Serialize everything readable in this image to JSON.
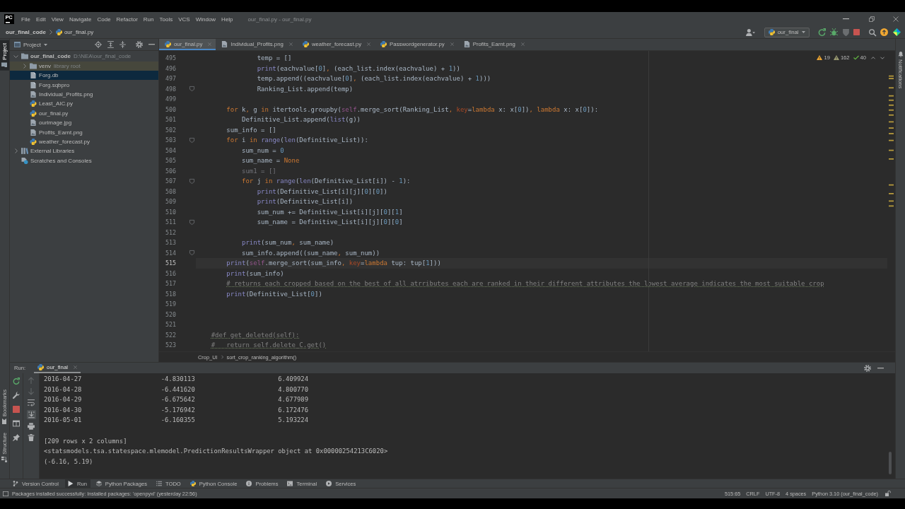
{
  "window": {
    "logo": "PC",
    "title": "our_final.py - our_final.py"
  },
  "menu": [
    "File",
    "Edit",
    "View",
    "Navigate",
    "Code",
    "Refactor",
    "Run",
    "Tools",
    "VCS",
    "Window",
    "Help"
  ],
  "navigation_bar": {
    "breadcrumb": [
      {
        "label": "our_final_code",
        "kind": "project"
      },
      {
        "label": "our_final.py",
        "kind": "python"
      }
    ],
    "run_configuration": "our_final"
  },
  "left_tool_strip": {
    "top": [
      {
        "label": "Project",
        "kind": "project",
        "selected": true
      }
    ],
    "bottom": [
      {
        "label": "Bookmarks",
        "kind": "bookmarks",
        "selected": false
      },
      {
        "label": "Structure",
        "kind": "structure",
        "selected": false
      }
    ]
  },
  "project_panel": {
    "title": "Project",
    "tree": [
      {
        "label": "our_final_code",
        "hint": "D:\\NEA\\our_final_code",
        "kind": "project",
        "expanded": true,
        "selected": false,
        "children": [
          {
            "label": "venv",
            "hint": "library root",
            "kind": "folder",
            "expanded": false,
            "selected": false,
            "color": "#46473c"
          },
          {
            "label": "Forg.db",
            "kind": "file",
            "selected": true
          },
          {
            "label": "Forg.sqbpro",
            "kind": "file",
            "selected": false
          },
          {
            "label": "Individual_Profits.png",
            "kind": "image",
            "selected": false
          },
          {
            "label": "Least_AIC.py",
            "kind": "python",
            "selected": false
          },
          {
            "label": "our_final.py",
            "kind": "python",
            "selected": false
          },
          {
            "label": "ourimage.jpg",
            "kind": "image",
            "selected": false
          },
          {
            "label": "Profits_Earnt.png",
            "kind": "image",
            "selected": false
          },
          {
            "label": "weather_forecast.py",
            "kind": "python",
            "selected": false
          }
        ]
      },
      {
        "label": "External Libraries",
        "kind": "library",
        "expanded": false,
        "selected": false
      },
      {
        "label": "Scratches and Consoles",
        "kind": "scratches",
        "selected": false
      }
    ]
  },
  "editor": {
    "tabs": [
      {
        "label": "our_final.py",
        "kind": "python",
        "selected": true
      },
      {
        "label": "Individual_Profits.png",
        "kind": "image",
        "selected": false
      },
      {
        "label": "weather_forecast.py",
        "kind": "python",
        "selected": false
      },
      {
        "label": "Passwordgenerator.py",
        "kind": "python",
        "selected": false
      },
      {
        "label": "Profits_Earnt.png",
        "kind": "image",
        "selected": false
      }
    ],
    "inspections": [
      {
        "kind": "warning",
        "count": "19"
      },
      {
        "kind": "weak_warning",
        "count": "162"
      },
      {
        "kind": "typo",
        "count": "40"
      }
    ],
    "lines": [
      {
        "number": "495",
        "current": false,
        "fold": false,
        "code": [
          {
            "text": "                temp = []",
            "kind": "txt"
          }
        ]
      },
      {
        "number": "496",
        "current": false,
        "fold": false,
        "code": [
          {
            "text": "                print",
            "kind": "fn"
          },
          {
            "text": "(eachvalue[",
            "kind": "txt"
          },
          {
            "text": "0",
            "kind": "num"
          },
          {
            "text": "]",
            "kind": "txt"
          },
          {
            "text": ",",
            "kind": "kw"
          },
          {
            "text": " (each_list.index(eachvalue) + ",
            "kind": "txt"
          },
          {
            "text": "1",
            "kind": "num"
          },
          {
            "text": "))",
            "kind": "txt"
          }
        ]
      },
      {
        "number": "497",
        "current": false,
        "fold": false,
        "code": [
          {
            "text": "                temp.append((eachvalue[",
            "kind": "txt"
          },
          {
            "text": "0",
            "kind": "num"
          },
          {
            "text": "]",
            "kind": "txt"
          },
          {
            "text": ",",
            "kind": "kw"
          },
          {
            "text": " (each_list.index(eachvalue) + ",
            "kind": "txt"
          },
          {
            "text": "1",
            "kind": "num"
          },
          {
            "text": ")))",
            "kind": "txt"
          }
        ]
      },
      {
        "number": "498",
        "current": false,
        "fold": true,
        "code": [
          {
            "text": "                Ranking_List.append(temp)",
            "kind": "txt"
          }
        ]
      },
      {
        "number": "499",
        "current": false,
        "fold": false
      },
      {
        "number": "500",
        "current": false,
        "fold": false,
        "code": [
          {
            "text": "        for",
            "kind": "kw"
          },
          {
            "text": " k",
            "kind": "txt"
          },
          {
            "text": ",",
            "kind": "kw"
          },
          {
            "text": " g ",
            "kind": "txt"
          },
          {
            "text": "in",
            "kind": "kw"
          },
          {
            "text": " itertools.groupby(",
            "kind": "txt"
          },
          {
            "text": "self",
            "kind": "self"
          },
          {
            "text": ".merge_sort(Ranking_List",
            "kind": "txt"
          },
          {
            "text": ",",
            "kind": "kw"
          },
          {
            "text": " key",
            "kind": "param"
          },
          {
            "text": "=",
            "kind": "txt"
          },
          {
            "text": "lambda",
            "kind": "kw"
          },
          {
            "text": " x: x[",
            "kind": "txt"
          },
          {
            "text": "0",
            "kind": "num"
          },
          {
            "text": "])",
            "kind": "txt"
          },
          {
            "text": ",",
            "kind": "kw"
          },
          {
            "text": " lambda",
            "kind": "kw"
          },
          {
            "text": " x: x[",
            "kind": "txt"
          },
          {
            "text": "0",
            "kind": "num"
          },
          {
            "text": "]):",
            "kind": "txt"
          }
        ]
      },
      {
        "number": "501",
        "current": false,
        "fold": false,
        "code": [
          {
            "text": "            Definitive_List.append(",
            "kind": "txt"
          },
          {
            "text": "list",
            "kind": "fn"
          },
          {
            "text": "(g))",
            "kind": "txt"
          }
        ]
      },
      {
        "number": "502",
        "current": false,
        "fold": false,
        "code": [
          {
            "text": "        sum_info = []",
            "kind": "txt"
          }
        ]
      },
      {
        "number": "503",
        "current": false,
        "fold": true,
        "code": [
          {
            "text": "        for",
            "kind": "kw"
          },
          {
            "text": " i ",
            "kind": "txt"
          },
          {
            "text": "in",
            "kind": "kw"
          },
          {
            "text": " range",
            "kind": "fn"
          },
          {
            "text": "(",
            "kind": "txt"
          },
          {
            "text": "len",
            "kind": "fn"
          },
          {
            "text": "(Definitive_List)):",
            "kind": "txt"
          }
        ]
      },
      {
        "number": "504",
        "current": false,
        "fold": false,
        "code": [
          {
            "text": "            sum_num = ",
            "kind": "txt"
          },
          {
            "text": "0",
            "kind": "num"
          }
        ]
      },
      {
        "number": "505",
        "current": false,
        "fold": false,
        "code": [
          {
            "text": "            sum_name = ",
            "kind": "txt"
          },
          {
            "text": "None",
            "kind": "kw"
          }
        ]
      },
      {
        "number": "506",
        "current": false,
        "fold": false,
        "code": [
          {
            "text": "            sum1 = []",
            "kind": "dim"
          }
        ]
      },
      {
        "number": "507",
        "current": false,
        "fold": true,
        "code": [
          {
            "text": "            for",
            "kind": "kw"
          },
          {
            "text": " j ",
            "kind": "txt"
          },
          {
            "text": "in",
            "kind": "kw"
          },
          {
            "text": " range",
            "kind": "fn"
          },
          {
            "text": "(",
            "kind": "txt"
          },
          {
            "text": "len",
            "kind": "fn"
          },
          {
            "text": "(Definitive_List[i]) - ",
            "kind": "txt"
          },
          {
            "text": "1",
            "kind": "num"
          },
          {
            "text": "):",
            "kind": "txt"
          }
        ]
      },
      {
        "number": "508",
        "current": false,
        "fold": false,
        "code": [
          {
            "text": "                print",
            "kind": "fn"
          },
          {
            "text": "(Definitive_List[i][j][",
            "kind": "txt"
          },
          {
            "text": "0",
            "kind": "num"
          },
          {
            "text": "][",
            "kind": "txt"
          },
          {
            "text": "0",
            "kind": "num"
          },
          {
            "text": "])",
            "kind": "txt"
          }
        ]
      },
      {
        "number": "509",
        "current": false,
        "fold": false,
        "code": [
          {
            "text": "                print",
            "kind": "fn"
          },
          {
            "text": "(Definitive_List[i])",
            "kind": "txt"
          }
        ]
      },
      {
        "number": "510",
        "current": false,
        "fold": false,
        "code": [
          {
            "text": "                sum_num += Definitive_List[i][j][",
            "kind": "txt"
          },
          {
            "text": "0",
            "kind": "num"
          },
          {
            "text": "][",
            "kind": "txt"
          },
          {
            "text": "1",
            "kind": "num"
          },
          {
            "text": "]",
            "kind": "txt"
          }
        ]
      },
      {
        "number": "511",
        "current": false,
        "fold": true,
        "code": [
          {
            "text": "                sum_name = Definitive_List[i][j][",
            "kind": "txt"
          },
          {
            "text": "0",
            "kind": "num"
          },
          {
            "text": "][",
            "kind": "txt"
          },
          {
            "text": "0",
            "kind": "num"
          },
          {
            "text": "]",
            "kind": "txt"
          }
        ]
      },
      {
        "number": "512",
        "current": false,
        "fold": false
      },
      {
        "number": "513",
        "current": false,
        "fold": false,
        "code": [
          {
            "text": "            print",
            "kind": "fn"
          },
          {
            "text": "(sum_num",
            "kind": "txt"
          },
          {
            "text": ",",
            "kind": "kw"
          },
          {
            "text": " sum_name)",
            "kind": "txt"
          }
        ]
      },
      {
        "number": "514",
        "current": false,
        "fold": true,
        "code": [
          {
            "text": "            sum_info.append((sum_name",
            "kind": "txt"
          },
          {
            "text": ",",
            "kind": "kw"
          },
          {
            "text": " sum_num))",
            "kind": "txt"
          }
        ]
      },
      {
        "number": "515",
        "current": true,
        "fold": false,
        "code": [
          {
            "text": "        print",
            "kind": "fn"
          },
          {
            "text": "(",
            "kind": "txt"
          },
          {
            "text": "self",
            "kind": "self"
          },
          {
            "text": ".merge_sort(sum_info",
            "kind": "txt"
          },
          {
            "text": ",",
            "kind": "kw"
          },
          {
            "text": " key",
            "kind": "param"
          },
          {
            "text": "=",
            "kind": "txt"
          },
          {
            "text": "lambda",
            "kind": "kw"
          },
          {
            "text": " tup: tup[",
            "kind": "txt"
          },
          {
            "text": "1",
            "kind": "num"
          },
          {
            "text": "]))",
            "kind": "txt"
          }
        ]
      },
      {
        "number": "516",
        "current": false,
        "fold": false,
        "code": [
          {
            "text": "        print",
            "kind": "fn"
          },
          {
            "text": "(sum_info)",
            "kind": "txt"
          }
        ]
      },
      {
        "number": "517",
        "current": false,
        "fold": false,
        "code": [
          {
            "text": "        # returns each cropped based on the best of all atrributes each are ranked in their different attributes the lowest average indicates the most suitable crop",
            "kind": "cmt"
          }
        ]
      },
      {
        "number": "518",
        "current": false,
        "fold": false,
        "code": [
          {
            "text": "        print",
            "kind": "fn"
          },
          {
            "text": "(Definitive_List[",
            "kind": "txt"
          },
          {
            "text": "0",
            "kind": "num"
          },
          {
            "text": "])",
            "kind": "txt"
          }
        ]
      },
      {
        "number": "519",
        "current": false,
        "fold": false
      },
      {
        "number": "520",
        "current": false,
        "fold": false
      },
      {
        "number": "521",
        "current": false,
        "fold": false
      },
      {
        "number": "522",
        "current": false,
        "fold": false,
        "code": [
          {
            "text": "    #def get_deleted(self):",
            "kind": "cmt"
          }
        ]
      },
      {
        "number": "523",
        "current": false,
        "fold": false,
        "code": [
          {
            "text": "    #   return self.delete_C.get()",
            "kind": "cmt"
          }
        ]
      }
    ],
    "breadcrumb": [
      "Crop_UI",
      "sort_crop_ranking_algorithm()"
    ]
  },
  "right_tool_strip": [
    {
      "label": "Notifications",
      "kind": "notifications"
    }
  ],
  "run_panel": {
    "title": "Run:",
    "tab": {
      "label": "our_final",
      "selected": true
    },
    "navigation_disabled": true,
    "autoscroll": true,
    "output": [
      {
        "lines": [
          "2016-04-27                     -4.830113                      6.409924",
          "2016-04-28                     -6.441620                      4.800770",
          "2016-04-29                     -6.675642                      4.677989",
          "2016-04-30                     -5.176942                      6.172476",
          "2016-05-01                     -6.160355                      5.193224"
        ]
      },
      {
        "lines": [
          "[209 rows x 2 columns]",
          "<statsmodels.tsa.statespace.mlemodel.PredictionResultsWrapper object at 0x00000254213C6020>",
          "(-6.16, 5.19)"
        ]
      }
    ]
  },
  "tool_window_bar": [
    {
      "label": "Version Control",
      "kind": "vcs",
      "selected": false
    },
    {
      "label": "Run",
      "kind": "run",
      "selected": true
    },
    {
      "label": "Python Packages",
      "kind": "packages",
      "selected": false
    },
    {
      "label": "TODO",
      "kind": "todo",
      "selected": false
    },
    {
      "label": "Python Console",
      "kind": "python",
      "selected": false
    },
    {
      "label": "Problems",
      "kind": "problems",
      "selected": false
    },
    {
      "label": "Terminal",
      "kind": "terminal",
      "selected": false
    },
    {
      "label": "Services",
      "kind": "services",
      "selected": false
    }
  ],
  "status_bar": {
    "message": "Packages installed successfully: Installed packages: 'openpyxl' (yesterday 22:56)",
    "items": [
      "515:65",
      "CRLF",
      "UTF-8",
      "4 spaces",
      "Python 3.10 (our_final_code)"
    ]
  }
}
